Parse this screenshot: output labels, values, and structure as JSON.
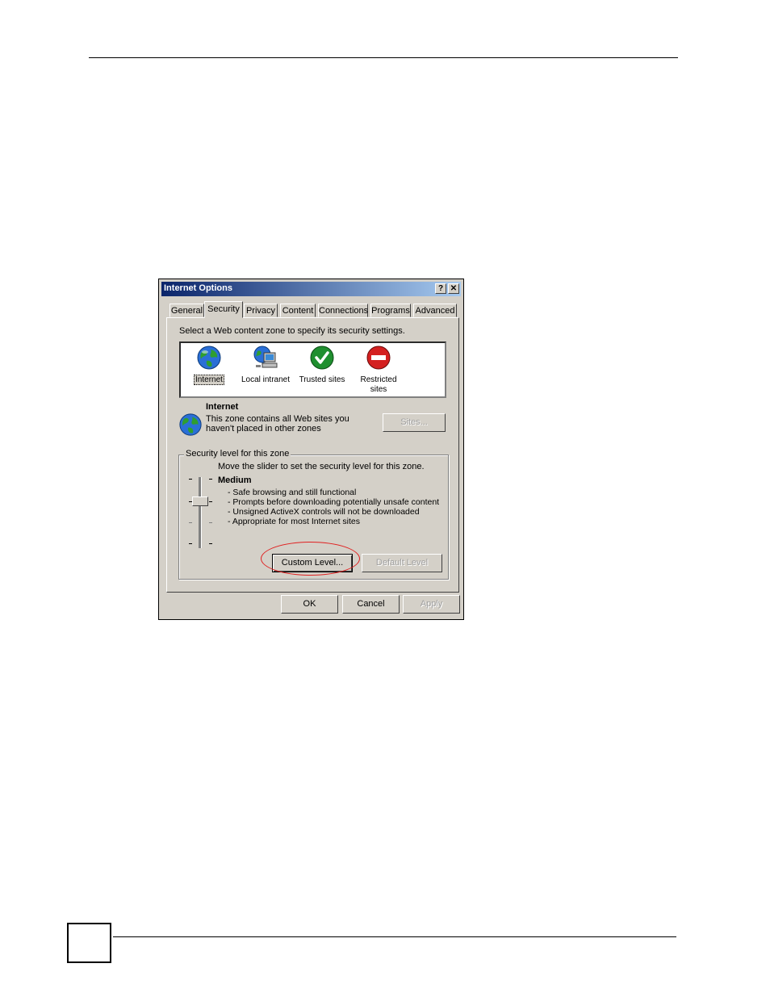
{
  "dialog": {
    "title": "Internet Options",
    "help_button": "?",
    "close_button": "✕"
  },
  "tabs": [
    "General",
    "Security",
    "Privacy",
    "Content",
    "Connections",
    "Programs",
    "Advanced"
  ],
  "active_tab": "Security",
  "security": {
    "instruction": "Select a Web content zone to specify its security settings.",
    "zones": [
      {
        "label_1": "Internet",
        "label_2": "",
        "icon": "globe-icon"
      },
      {
        "label_1": "Local intranet",
        "label_2": "",
        "icon": "network-computer-icon"
      },
      {
        "label_1": "Trusted sites",
        "label_2": "",
        "icon": "checkmark-icon"
      },
      {
        "label_1": "Restricted",
        "label_2": "sites",
        "icon": "no-entry-icon"
      }
    ],
    "selected_zone": {
      "name": "Internet",
      "desc_1": "This zone contains all Web sites you",
      "desc_2": "haven't placed in other zones"
    },
    "sites_button": "Sites...",
    "level_group_label": "Security level for this zone",
    "slider_instruction": "Move the slider to set the security level for this zone.",
    "level_name": "Medium",
    "level_items": [
      "- Safe browsing and still functional",
      "- Prompts before downloading potentially unsafe content",
      "- Unsigned ActiveX controls will not be downloaded",
      "- Appropriate for most Internet sites"
    ],
    "custom_level_button": "Custom Level...",
    "default_level_button": "Default Level"
  },
  "footer": {
    "ok": "OK",
    "cancel": "Cancel",
    "apply": "Apply"
  },
  "colors": {
    "title_bar": "#0a246a",
    "dialog_bg": "#d4d0c8",
    "highlight_ellipse": "#e02020"
  }
}
